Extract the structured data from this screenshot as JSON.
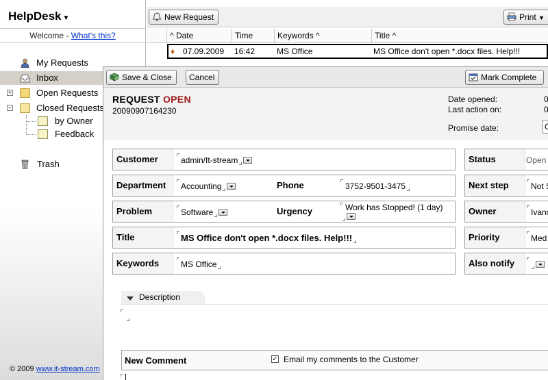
{
  "sidebar": {
    "title": "HelpDesk",
    "welcome_prefix": "Welcome - ",
    "welcome_link": "What's this?",
    "items": {
      "my_requests": "My Requests",
      "inbox": "Inbox",
      "open_requests": "Open Requests",
      "closed_requests": "Closed Requests",
      "by_owner": "by Owner",
      "feedback": "Feedback",
      "trash": "Trash"
    },
    "footer_prefix": "© 2009 ",
    "footer_link": "www.it-stream.com"
  },
  "list": {
    "new_request": "New Request",
    "print": "Print",
    "columns": {
      "date": "Date",
      "time": "Time",
      "keywords": "Keywords",
      "title": "Title"
    },
    "row": {
      "date": "07.09.2009",
      "time": "16:42",
      "keywords": "MS Office",
      "title": "MS Office don't open *.docx files. Help!!!"
    }
  },
  "panel": {
    "toolbar": {
      "save_close": "Save & Close",
      "cancel": "Cancel",
      "mark_complete": "Mark Complete"
    },
    "header": {
      "request_label": "REQUEST",
      "status_label": "OPEN",
      "request_id": "20090907164230",
      "date_opened_label": "Date opened:",
      "last_action_label": "Last action on:",
      "promise_date_label": "Promise date:",
      "date_opened_value": "0",
      "last_action_value": "0",
      "promise_date_value": "C"
    },
    "fields": {
      "customer_label": "Customer",
      "customer_value": "admin/It-stream",
      "department_label": "Department",
      "department_value": "Accounting",
      "phone_label": "Phone",
      "phone_value": "3752-9501-3475",
      "problem_label": "Problem",
      "problem_value": "Software",
      "urgency_label": "Urgency",
      "urgency_value": "Work has Stopped! (1 day)",
      "title_label": "Title",
      "title_value": "MS Office don't open *.docx files. Help!!!",
      "keywords_label": "Keywords",
      "keywords_value": "MS Office",
      "status_label": "Status",
      "status_value": "Open",
      "next_step_label": "Next step",
      "next_step_value": "Not S",
      "owner_label": "Owner",
      "owner_value": "Ivano",
      "priority_label": "Priority",
      "priority_value": "Med",
      "also_notify_label": "Also notify"
    },
    "description_label": "Description",
    "new_comment_label": "New Comment",
    "email_checkbox_label": "Email my comments to the Customer",
    "email_checkbox_checked": true
  },
  "colors": {
    "status_open": "#a01818",
    "link": "#0033cc"
  }
}
